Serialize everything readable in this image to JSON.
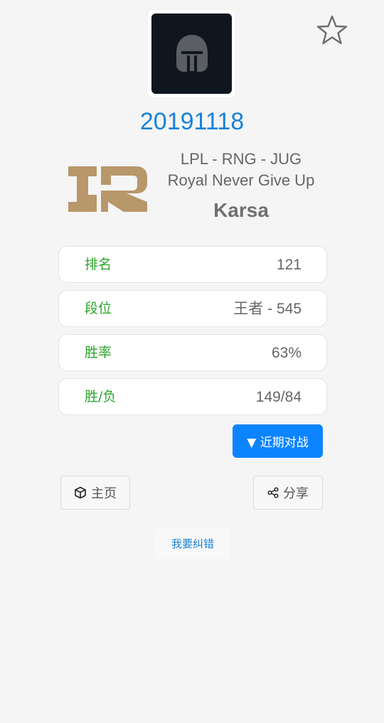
{
  "player": {
    "id": "20191118",
    "league_line": "LPL - RNG - JUG",
    "team_name": "Royal Never Give Up",
    "nickname": "Karsa"
  },
  "stats": [
    {
      "label": "排名",
      "value": "121"
    },
    {
      "label": "段位",
      "value": "王者 - 545"
    },
    {
      "label": "胜率",
      "value": "63%"
    },
    {
      "label": "胜/负",
      "value": "149/84"
    }
  ],
  "actions": {
    "recent_matches": "▼ 近期对战",
    "home": "主页",
    "share": "分享",
    "report_error": "我要纠错"
  },
  "icons": {
    "avatar": "helmet-icon",
    "favorite": "star-icon",
    "home": "cube-icon",
    "share": "share-icon",
    "team_logo": "rng-logo"
  },
  "colors": {
    "accent_blue": "#1a82d9",
    "button_blue": "#0d84ff",
    "label_green": "#2aa52a",
    "logo_gold": "#b8976a",
    "avatar_bg": "#0f1620"
  }
}
